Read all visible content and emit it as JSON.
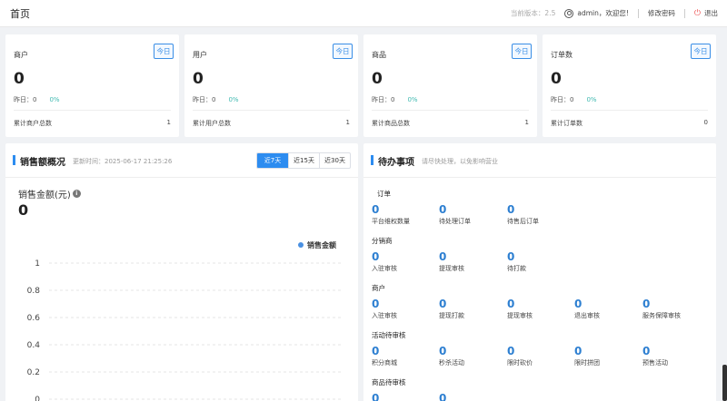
{
  "header": {
    "title": "首页",
    "version": "当前版本：2.5",
    "user": "admin，欢迎您!",
    "change_pwd": "修改密码",
    "logout": "退出"
  },
  "stats": [
    {
      "title": "商户",
      "today": "今日",
      "value": "0",
      "yest_label": "昨日：0",
      "pct": "0%",
      "foot_label": "累计商户总数",
      "foot_value": "1"
    },
    {
      "title": "用户",
      "today": "今日",
      "value": "0",
      "yest_label": "昨日：0",
      "pct": "0%",
      "foot_label": "累计用户总数",
      "foot_value": "1"
    },
    {
      "title": "商品",
      "today": "今日",
      "value": "0",
      "yest_label": "昨日：0",
      "pct": "0%",
      "foot_label": "累计商品总数",
      "foot_value": "1"
    },
    {
      "title": "订单数",
      "today": "今日",
      "value": "0",
      "yest_label": "昨日：0",
      "pct": "0%",
      "foot_label": "累计订单数",
      "foot_value": "0"
    }
  ],
  "sales": {
    "title": "销售额概况",
    "updated": "更新时间：2025-06-17 21:25:26",
    "tabs": [
      "近7天",
      "近15天",
      "近30天"
    ],
    "active_tab": "近7天",
    "amount_label": "销售金额(元)",
    "amount_value": "0"
  },
  "chart_data": {
    "type": "line",
    "series": [
      {
        "name": "销售金额",
        "values": []
      }
    ],
    "y_ticks": [
      "1",
      "0.8",
      "0.6",
      "0.4",
      "0.2",
      "0"
    ],
    "ylim": [
      0,
      1
    ],
    "legend": "top-right",
    "grid": true,
    "color": "#4a90e2"
  },
  "todo": {
    "title": "待办事项",
    "subtitle": "请尽快处理，以免影响营业",
    "groups": [
      {
        "name": "订单",
        "items": [
          {
            "value": "0",
            "label": "平台维权数量"
          },
          {
            "value": "0",
            "label": "待处理订单"
          },
          {
            "value": "0",
            "label": "待售后订单"
          }
        ]
      },
      {
        "name": "分销商",
        "items": [
          {
            "value": "0",
            "label": "入驻审核"
          },
          {
            "value": "0",
            "label": "提现审核"
          },
          {
            "value": "0",
            "label": "待打款"
          }
        ]
      },
      {
        "name": "商户",
        "items": [
          {
            "value": "0",
            "label": "入驻审核"
          },
          {
            "value": "0",
            "label": "提现打款"
          },
          {
            "value": "0",
            "label": "提现审核"
          },
          {
            "value": "0",
            "label": "退出审核"
          },
          {
            "value": "0",
            "label": "服务保障审核"
          }
        ]
      },
      {
        "name": "活动待审核",
        "items": [
          {
            "value": "0",
            "label": "积分商城"
          },
          {
            "value": "0",
            "label": "秒杀活动"
          },
          {
            "value": "0",
            "label": "限时砍价"
          },
          {
            "value": "0",
            "label": "限时拼团"
          },
          {
            "value": "0",
            "label": "预售活动"
          }
        ]
      },
      {
        "name": "商品待审核",
        "items": [
          {
            "value": "0",
            "label": ""
          },
          {
            "value": "0",
            "label": ""
          }
        ]
      }
    ]
  }
}
